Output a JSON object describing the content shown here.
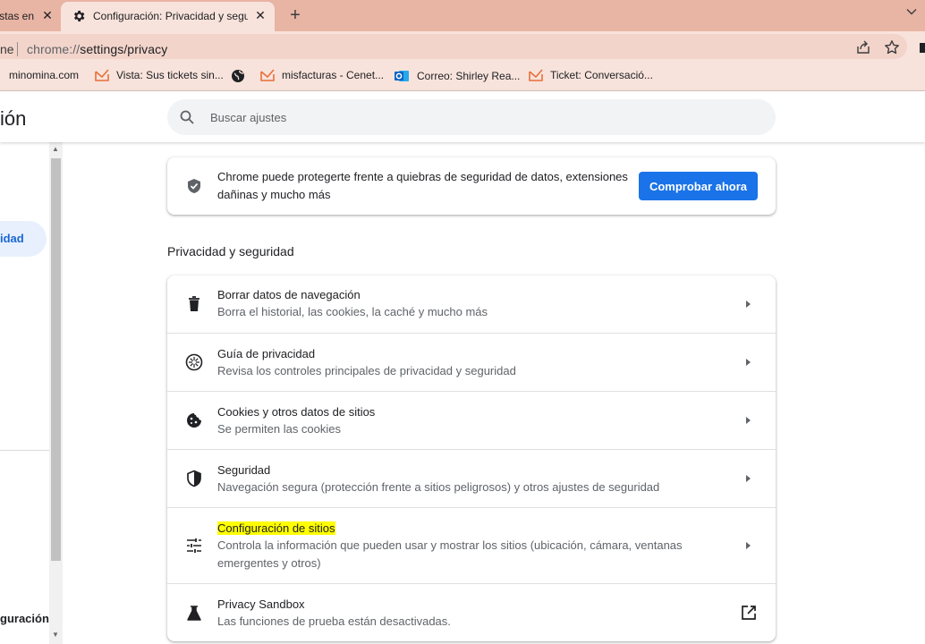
{
  "tabs": [
    {
      "title": "Listas en",
      "active": false
    },
    {
      "title": "Configuración: Privacidad y seguridad",
      "active": true
    }
  ],
  "omnibox": {
    "left_text": "ne",
    "url_scheme": "chrome://",
    "url_path": "settings/privacy"
  },
  "bookmarks": [
    {
      "label": "minomina.com",
      "icon": "none"
    },
    {
      "label": "Vista: Sus tickets sin...",
      "icon": "zendesk-icon"
    },
    {
      "label": "",
      "icon": "globe-icon"
    },
    {
      "label": "misfacturas - Cenet...",
      "icon": "zendesk-icon"
    },
    {
      "label": "Correo: Shirley Rea...",
      "icon": "outlook-icon"
    },
    {
      "label": "Ticket: Conversació...",
      "icon": "zendesk-icon"
    }
  ],
  "header": {
    "title": "ión",
    "search_placeholder": "Buscar ajustes"
  },
  "leftnav": {
    "active_label": "idad",
    "bottom_label": "guración"
  },
  "safety_check": {
    "text": "Chrome puede protegerte frente a quiebras de seguridad de datos, extensiones dañinas y mucho más",
    "button_label": "Comprobar ahora"
  },
  "section": {
    "title": "Privacidad y seguridad",
    "rows": [
      {
        "title": "Borrar datos de navegación",
        "subtitle": "Borra el historial, las cookies, la caché y mucho más",
        "icon": "trash-icon",
        "action": "arrow"
      },
      {
        "title": "Guía de privacidad",
        "subtitle": "Revisa los controles principales de privacidad y seguridad",
        "icon": "compass-icon",
        "action": "arrow"
      },
      {
        "title": "Cookies y otros datos de sitios",
        "subtitle": "Se permiten las cookies",
        "icon": "cookie-icon",
        "action": "arrow"
      },
      {
        "title": "Seguridad",
        "subtitle": "Navegación segura (protección frente a sitios peligrosos) y otros ajustes de seguridad",
        "icon": "shield-icon",
        "action": "arrow"
      },
      {
        "title": "Configuración de sitios",
        "subtitle": "Controla la información que pueden usar y mostrar los sitios (ubicación, cámara, ventanas emergentes y otros)",
        "icon": "tune-icon",
        "action": "arrow",
        "highlighted": true
      },
      {
        "title": "Privacy Sandbox",
        "subtitle": "Las funciones de prueba están desactivadas.",
        "icon": "flask-icon",
        "action": "external"
      }
    ]
  },
  "colors": {
    "tabstrip": "#e8b4a4",
    "toolbar": "#f8e3dc",
    "accent": "#1a73e8",
    "highlight": "#ffff00"
  }
}
